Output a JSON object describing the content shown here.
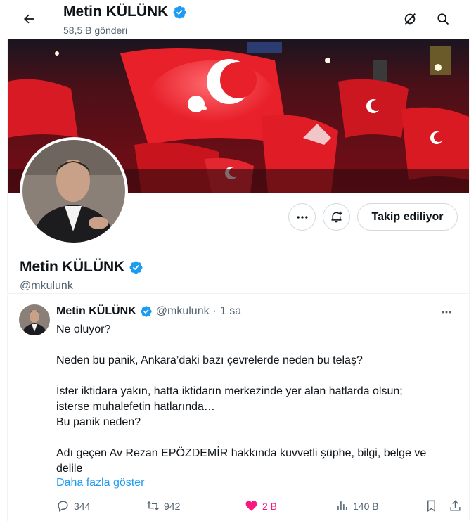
{
  "header": {
    "name": "Metin KÜLÜNK",
    "post_count": "58,5 B gönderi"
  },
  "profile": {
    "name": "Metin KÜLÜNK",
    "handle": "@mkulunk",
    "follow_label": "Takip ediliyor"
  },
  "tweet": {
    "name": "Metin KÜLÜNK",
    "handle": "@mkulunk",
    "sep": "·",
    "time": "1 sa",
    "paragraphs": [
      "Ne oluyor?",
      "Neden bu panik, Ankara’daki bazı çevrelerde neden bu telaş?",
      "İster iktidara yakın, hatta iktidarın merkezinde yer alan hatlarda olsun;\nisterse muhalefetin hatlarında…\nBu panik neden?",
      "Adı geçen Av Rezan EPÖZDEMİR hakkında kuvvetli şüphe, bilgi, belge ve\ndelile"
    ],
    "show_more": "Daha fazla göster",
    "replies": "344",
    "retweets": "942",
    "likes": "2 B",
    "views": "140 B"
  },
  "colors": {
    "accent": "#1d9bf0",
    "like": "#f91880",
    "muted": "#536471",
    "verified": "#1d9bf0"
  },
  "icons": [
    "back-arrow-icon",
    "verified-badge-icon",
    "grok-icon",
    "search-icon",
    "more-icon",
    "notification-add-icon",
    "reply-icon",
    "retweet-icon",
    "heart-icon",
    "views-icon",
    "bookmark-icon",
    "share-icon"
  ]
}
